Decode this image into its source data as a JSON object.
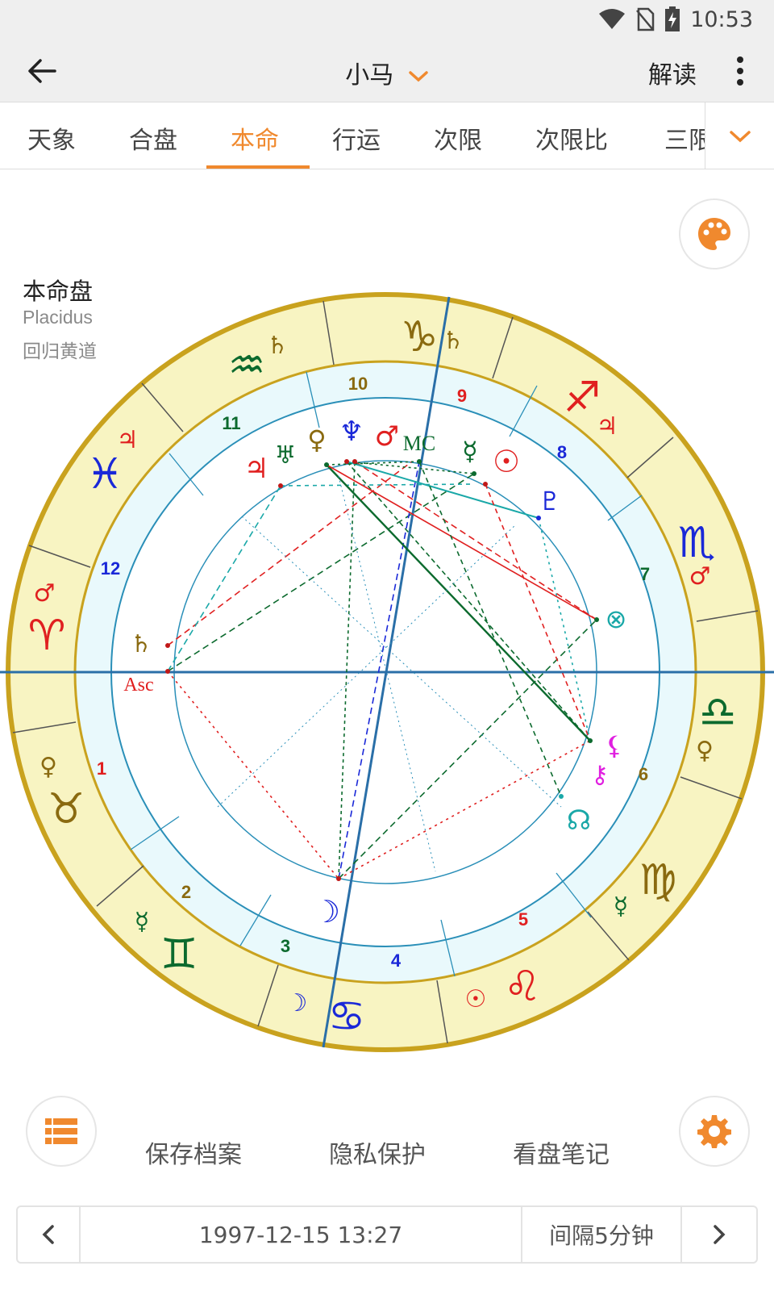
{
  "status_bar": {
    "time": "10:53",
    "icons": [
      "wifi-icon",
      "no-sim-icon",
      "battery-charging-icon"
    ]
  },
  "app_bar": {
    "title": "小马",
    "read_label": "解读"
  },
  "tabs": [
    {
      "label": "天象",
      "active": false
    },
    {
      "label": "合盘",
      "active": false
    },
    {
      "label": "本命",
      "active": true
    },
    {
      "label": "行运",
      "active": false
    },
    {
      "label": "次限",
      "active": false
    },
    {
      "label": "次限比",
      "active": false
    },
    {
      "label": "三限",
      "active": false
    }
  ],
  "chart_info": {
    "title": "本命盘",
    "house_system": "Placidus",
    "zodiac": "回归黄道"
  },
  "wheel": {
    "angles": [
      "Asc",
      "MC"
    ],
    "house_numbers": [
      "1",
      "2",
      "3",
      "4",
      "5",
      "6",
      "7",
      "8",
      "9",
      "10",
      "11",
      "12"
    ],
    "signs": [
      {
        "name": "aries",
        "symbol": "♈",
        "ruler": "♂"
      },
      {
        "name": "taurus",
        "symbol": "♉",
        "ruler": "♀"
      },
      {
        "name": "gemini",
        "symbol": "♊",
        "ruler": "☿"
      },
      {
        "name": "cancer",
        "symbol": "♋",
        "ruler": "☽"
      },
      {
        "name": "leo",
        "symbol": "♌",
        "ruler": "☉"
      },
      {
        "name": "virgo",
        "symbol": "♍",
        "ruler": "☿"
      },
      {
        "name": "libra",
        "symbol": "♎",
        "ruler": "♀"
      },
      {
        "name": "scorpio",
        "symbol": "♏",
        "ruler": "♂"
      },
      {
        "name": "sagittarius",
        "symbol": "♐",
        "ruler": "♃"
      },
      {
        "name": "capricorn",
        "symbol": "♑",
        "ruler": "♄"
      },
      {
        "name": "aquarius",
        "symbol": "♒",
        "ruler": "♄"
      },
      {
        "name": "pisces",
        "symbol": "♓",
        "ruler": "♃"
      }
    ],
    "planets": [
      {
        "name": "sun",
        "symbol": "☉"
      },
      {
        "name": "moon",
        "symbol": "☽"
      },
      {
        "name": "mercury",
        "symbol": "☿"
      },
      {
        "name": "venus",
        "symbol": "♀"
      },
      {
        "name": "mars",
        "symbol": "♂"
      },
      {
        "name": "jupiter",
        "symbol": "♃"
      },
      {
        "name": "saturn",
        "symbol": "♄"
      },
      {
        "name": "uranus",
        "symbol": "♅"
      },
      {
        "name": "neptune",
        "symbol": "♆"
      },
      {
        "name": "pluto",
        "symbol": "♇"
      },
      {
        "name": "north-node",
        "symbol": "☊"
      },
      {
        "name": "part-of-fortune",
        "symbol": "⊗"
      },
      {
        "name": "lilith",
        "symbol": "⚸"
      },
      {
        "name": "chiron",
        "symbol": "⚷"
      }
    ],
    "colors": {
      "ring": "#c9a21e",
      "sign_band": "#f8f4c2",
      "house_band": "#e9f9fc",
      "axis": "#2a6fa8"
    }
  },
  "bottom_actions": {
    "save": "保存档案",
    "privacy": "隐私保护",
    "notes": "看盘笔记"
  },
  "time_control": {
    "datetime": "1997-12-15 13:27",
    "interval": "间隔5分钟"
  },
  "accent_color": "#f0892e"
}
